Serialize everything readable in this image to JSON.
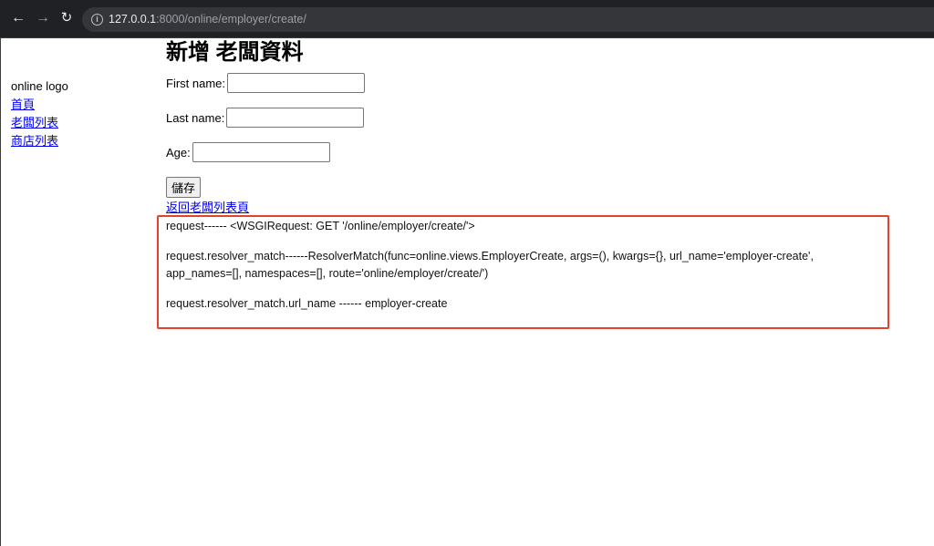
{
  "browser": {
    "url_host": "127.0.0.1",
    "url_path": ":8000/online/employer/create/",
    "back_icon": "arrow-left-icon",
    "forward_icon": "arrow-right-icon",
    "reload_icon": "reload-icon",
    "info_icon": "info-icon"
  },
  "sidebar": {
    "logo": "online logo",
    "links": [
      "首頁",
      "老闆列表",
      "商店列表"
    ]
  },
  "form": {
    "title": "新增 老闆資料",
    "fields": [
      {
        "label": "First name:",
        "value": ""
      },
      {
        "label": "Last name:",
        "value": ""
      },
      {
        "label": "Age:",
        "value": ""
      }
    ],
    "save_label": "儲存",
    "back_link": "返回老闆列表頁"
  },
  "debug": {
    "line1": "request------ <WSGIRequest: GET '/online/employer/create/'>",
    "line2a": "request.resolver_match------ResolverMatch(func=online.views.EmployerCreate, args=(), kwargs={}, url_name='employer-create',",
    "line2b": "app_names=[], namespaces=[], route='online/employer/create/')",
    "line3": "request.resolver_match.url_name ------ employer-create"
  },
  "colors": {
    "highlight_border": "#e5412c",
    "link": "#0000ee"
  }
}
